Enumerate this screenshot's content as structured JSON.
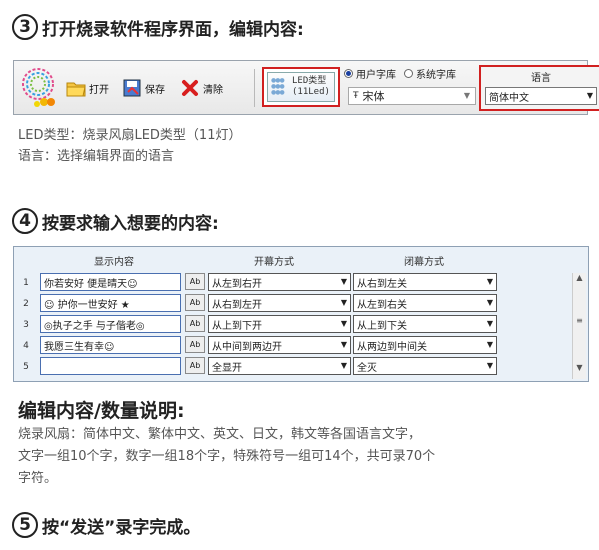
{
  "step3": {
    "num": "3",
    "text": "打开烧录软件程序界面，编辑内容:"
  },
  "toolbar": {
    "open_label": "打开",
    "save_label": "保存",
    "clear_label": "清除",
    "led_type_line1": "LED类型",
    "led_type_line2": "(11Led)",
    "font_user": "用户字库",
    "font_system": "系统字库",
    "font_value": "宋体",
    "language_title": "语言",
    "language_value": "简体中文"
  },
  "desc": {
    "led_type": "LED类型：烧录风扇LED类型（11灯）",
    "language": "语言：选择编辑界面的语言"
  },
  "step4": {
    "num": "4",
    "text": "按要求输入想要的内容:"
  },
  "grid": {
    "headers": [
      "显示内容",
      "开幕方式",
      "闭幕方式"
    ],
    "rows": [
      {
        "num": "1",
        "content": "你若安好 便是晴天☺",
        "open": "从左到右开",
        "close": "从右到左关"
      },
      {
        "num": "2",
        "content": "☺ 护你一世安好 ★",
        "open": "从右到左开",
        "close": "从左到右关"
      },
      {
        "num": "3",
        "content": "◎执子之手 与子偕老◎",
        "open": "从上到下开",
        "close": "从上到下关"
      },
      {
        "num": "4",
        "content": "我愿三生有幸☺",
        "open": "从中间到两边开",
        "close": "从两边到中间关"
      },
      {
        "num": "5",
        "content": "",
        "open": "全显开",
        "close": "全灭"
      }
    ],
    "icon_label": "Ab"
  },
  "section": {
    "title": "编辑内容/数量说明:",
    "line1": "烧录风扇：简体中文、繁体中文、英文、日文，韩文等各国语言文字，",
    "line2": "文字一组10个字，数字一组18个字，特殊符号一组可14个，共可录70个",
    "line3": "字符。"
  },
  "step5": {
    "num": "5",
    "text": "按“发送”录字完成。"
  }
}
